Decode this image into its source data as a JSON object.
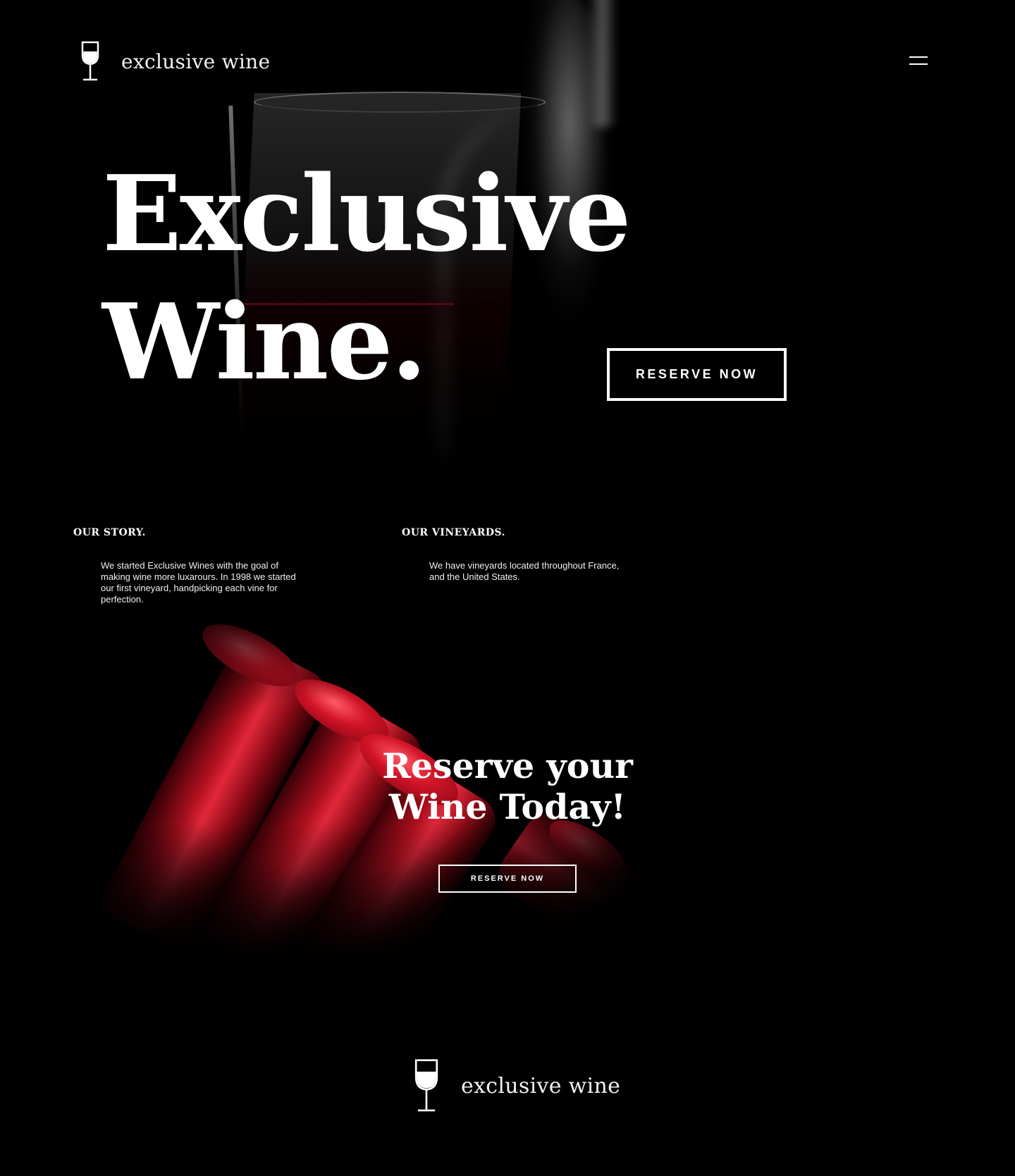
{
  "brand": {
    "name": "exclusive wine",
    "icon": "wine-glass-icon"
  },
  "nav": {
    "menu_icon": "hamburger-menu-icon"
  },
  "hero": {
    "title_line1": "Exclusive",
    "title_line2": "Wine.",
    "cta_label": "RESERVE NOW"
  },
  "story": {
    "heading": "OUR STORY.",
    "body": "We started Exclusive Wines with the goal of making wine more luxarours. In 1998 we started our first vineyard, handpicking each vine for perfection."
  },
  "vineyards": {
    "heading": "OUR VINEYARDS.",
    "body": "We have vineyards located throughout France, and the United States."
  },
  "cta": {
    "title_line1": "Reserve your",
    "title_line2": "Wine Today!",
    "button_label": "RESERVE NOW"
  },
  "footer": {
    "brand_name": "exclusive wine"
  },
  "colors": {
    "background": "#000000",
    "text": "#ffffff",
    "accent_red": "#d21428"
  }
}
